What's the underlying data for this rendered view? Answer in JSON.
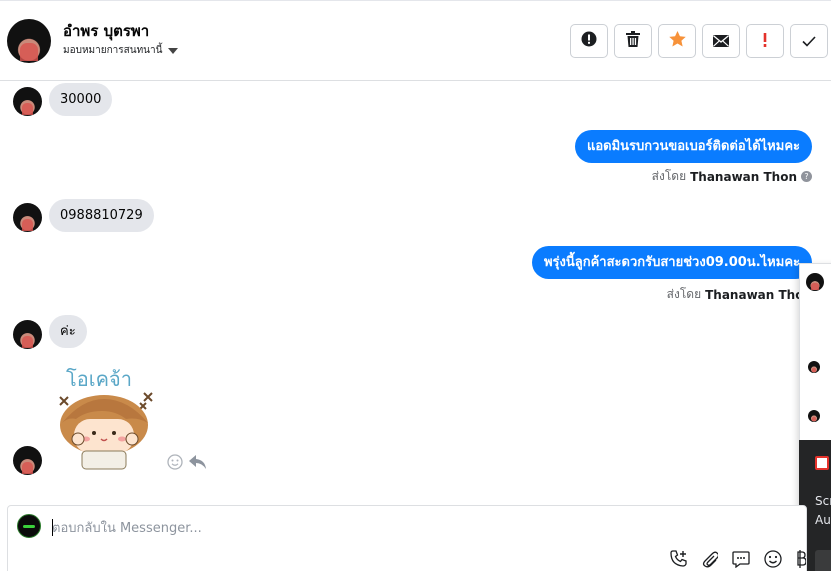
{
  "header": {
    "contact_name": "อำพร บุตรพา",
    "assign_label": "มอบหมายการสนทนานี้",
    "toolbar": [
      {
        "name": "alert-icon",
        "label": "Mark as spam"
      },
      {
        "name": "trash-icon",
        "label": "Delete"
      },
      {
        "name": "star-icon",
        "label": "Star"
      },
      {
        "name": "mail-icon",
        "label": "Mark unread"
      },
      {
        "name": "exclamation-icon",
        "label": "Important"
      },
      {
        "name": "check-icon",
        "label": "Done"
      }
    ]
  },
  "messages": [
    {
      "dir": "in",
      "text": "30000"
    },
    {
      "dir": "out",
      "text": "แอดมินรบกวนขอเบอร์ติดต่อได้ไหมคะ",
      "sent_by_prefix": "ส่งโดย",
      "sent_by": "Thanawan Thon"
    },
    {
      "dir": "in",
      "text": "0988810729"
    },
    {
      "dir": "out",
      "text": "พรุ่งนี้ลูกค้าสะดวกรับสายช่วง09.00น.ไหมคะ",
      "sent_by_prefix": "ส่งโดย",
      "sent_by": "Thanawan Thon"
    },
    {
      "dir": "in",
      "text": "ค่ะ"
    },
    {
      "dir": "in",
      "type": "sticker",
      "sticker_text": "โอเคจ้า"
    }
  ],
  "side_panel": {
    "dark_text_1": "Scr",
    "dark_text_2": "Au"
  },
  "composer": {
    "placeholder": "ตอบกลับใน Messenger..."
  },
  "colors": {
    "outgoing": "#0a7cff",
    "incoming": "#e4e6eb",
    "star": "#f7923a",
    "danger": "#e4322b"
  }
}
